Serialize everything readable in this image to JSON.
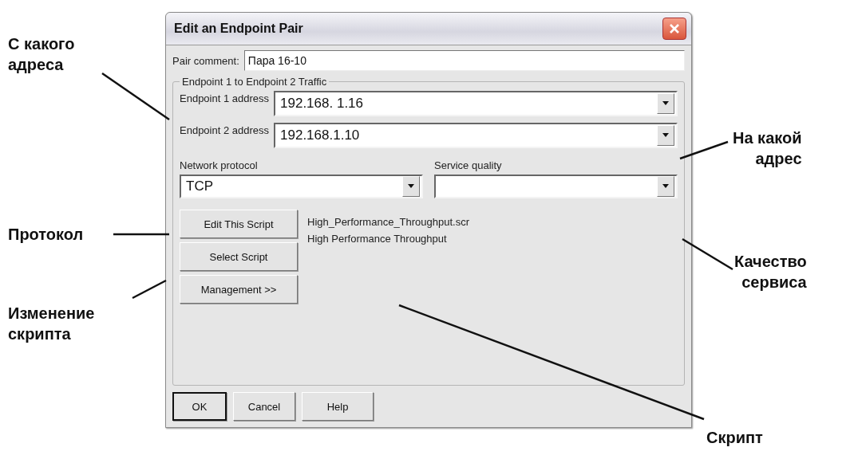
{
  "dialog": {
    "title": "Edit an Endpoint Pair",
    "pair_comment": {
      "label": "Pair comment:",
      "value": "Пара 16-10"
    },
    "traffic_group": {
      "title": "Endpoint 1 to Endpoint 2 Traffic",
      "endpoints": [
        {
          "label": "Endpoint 1 address",
          "value": "192.168. 1.16"
        },
        {
          "label": "Endpoint 2 address",
          "value": "192.168.1.10"
        }
      ],
      "network_protocol": {
        "label": "Network protocol",
        "value": "TCP"
      },
      "service_quality": {
        "label": "Service quality"
      },
      "script_buttons": [
        "Edit This Script",
        "Select Script",
        "Management >>"
      ],
      "script_file": "High_Performance_Throughput.scr",
      "script_name": "High Performance Throughput"
    },
    "buttons": [
      {
        "label": "OK",
        "default": true
      },
      {
        "label": "Cancel",
        "default": false
      },
      {
        "label": "Help",
        "default": false
      }
    ]
  },
  "callouts": [
    {
      "lines": [
        "С какого",
        "адреса"
      ]
    },
    {
      "lines": [
        "На какой",
        "адрес"
      ]
    },
    {
      "lines": [
        "Протокол"
      ]
    },
    {
      "lines": [
        "Качество",
        "сервиса"
      ]
    },
    {
      "lines": [
        "Изменение",
        "скрипта"
      ]
    },
    {
      "lines": [
        "Скрипт"
      ]
    }
  ]
}
